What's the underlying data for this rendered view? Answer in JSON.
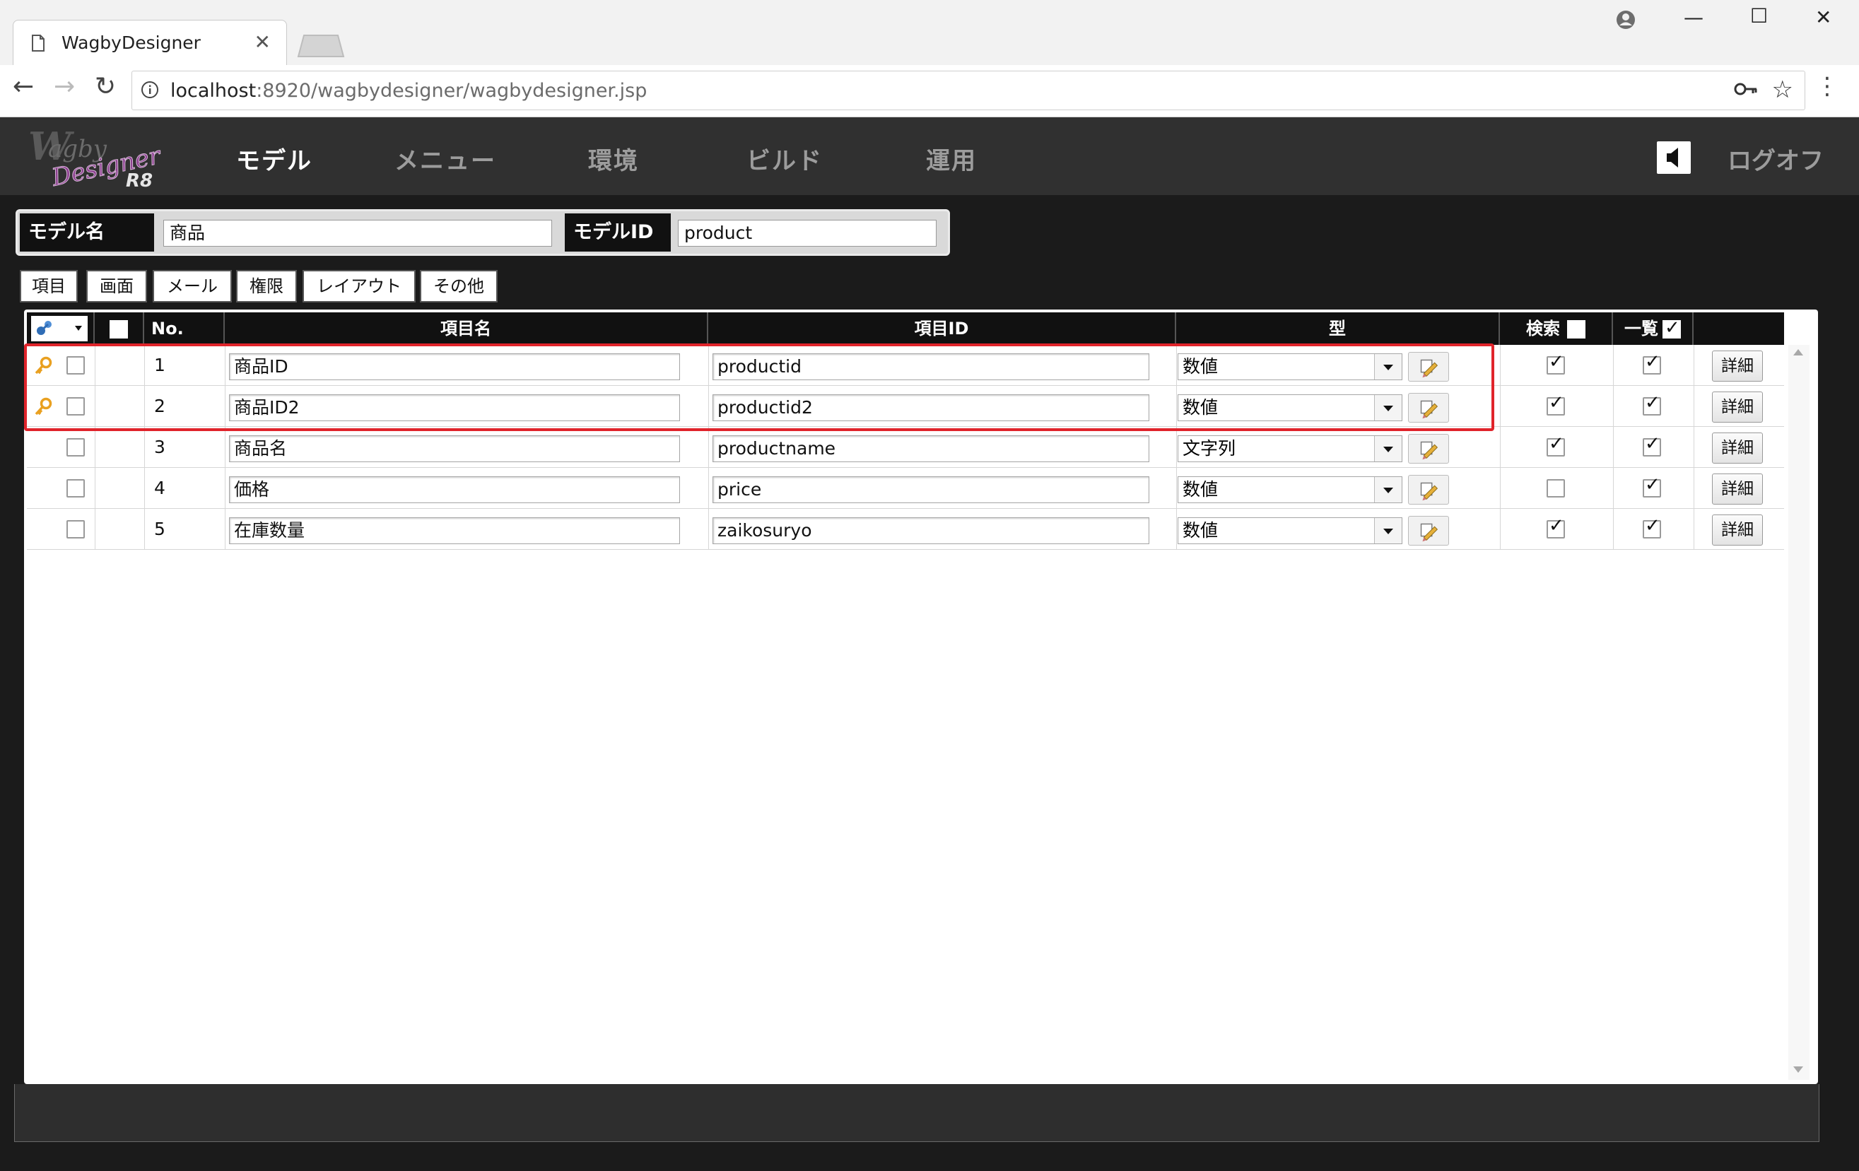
{
  "browser": {
    "tab_title": "WagbyDesigner",
    "url_host": "localhost",
    "url_path": ":8920/wagbydesigner/wagbydesigner.jsp"
  },
  "header": {
    "nav": [
      "モデル",
      "メニュー",
      "環境",
      "ビルド",
      "運用"
    ],
    "active_nav": "モデル",
    "logoff_label": "ログオフ"
  },
  "model_bar": {
    "name_label": "モデル名",
    "name_value": "商品",
    "id_label": "モデルID",
    "id_value": "product"
  },
  "subtabs": [
    "項目",
    "画面",
    "メール",
    "権限",
    "レイアウト",
    "その他"
  ],
  "table": {
    "headers": {
      "no": "No.",
      "item_name": "項目名",
      "item_id": "項目ID",
      "type": "型",
      "search": "検索",
      "list": "一覧"
    },
    "header_search_checked": false,
    "header_list_checked": true,
    "rows": [
      {
        "no": "1",
        "key": true,
        "name": "商品ID",
        "id": "productid",
        "type": "数値",
        "search": true,
        "list": true,
        "detail": "詳細"
      },
      {
        "no": "2",
        "key": true,
        "name": "商品ID2",
        "id": "productid2",
        "type": "数値",
        "search": true,
        "list": true,
        "detail": "詳細"
      },
      {
        "no": "3",
        "key": false,
        "name": "商品名",
        "id": "productname",
        "type": "文字列",
        "search": true,
        "list": true,
        "detail": "詳細"
      },
      {
        "no": "4",
        "key": false,
        "name": "価格",
        "id": "price",
        "type": "数値",
        "search": false,
        "list": true,
        "detail": "詳細"
      },
      {
        "no": "5",
        "key": false,
        "name": "在庫数量",
        "id": "zaikosuryo",
        "type": "数値",
        "search": true,
        "list": true,
        "detail": "詳細"
      }
    ]
  },
  "colors": {
    "highlight": "#e0242b",
    "key_icon": "#e9a020",
    "header_bg": "#303030"
  }
}
